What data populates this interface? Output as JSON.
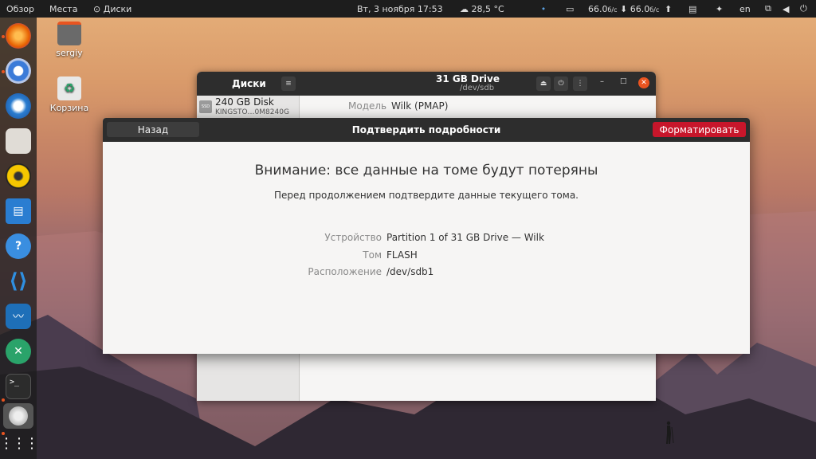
{
  "topbar": {
    "overview": "Обзор",
    "places": "Места",
    "app": "Диски",
    "datetime": "Вт, 3 ноября  17:53",
    "weather": "28,5 °C",
    "net_down": "66.0",
    "net_down_unit": "б/с",
    "net_up": "66.0",
    "net_up_unit": "б/с",
    "lang": "en"
  },
  "desktop": {
    "home_label": "sergiy",
    "trash_label": "Корзина"
  },
  "disks_window": {
    "sidebar_title": "Диски",
    "drive_title": "31 GB Drive",
    "drive_path": "/dev/sdb",
    "disk_name": "240 GB Disk",
    "disk_model": "KINGSTO…0M8240G",
    "model_label": "Модель",
    "model_value": "Wilk (PMAP)"
  },
  "dialog": {
    "back": "Назад",
    "title": "Подтвердить подробности",
    "format": "Форматировать",
    "warning": "Внимание: все данные на томе будут потеряны",
    "subtitle": "Перед продолжением подтвердите данные текущего тома.",
    "device_label": "Устройство",
    "device_value": "Partition 1 of 31 GB Drive — Wilk",
    "volume_label": "Том",
    "volume_value": "FLASH",
    "location_label": "Расположение",
    "location_value": "/dev/sdb1"
  },
  "colors": {
    "accent": "#c7162b",
    "ubuntu_orange": "#e95420",
    "titlebar": "#2d2d2d"
  }
}
